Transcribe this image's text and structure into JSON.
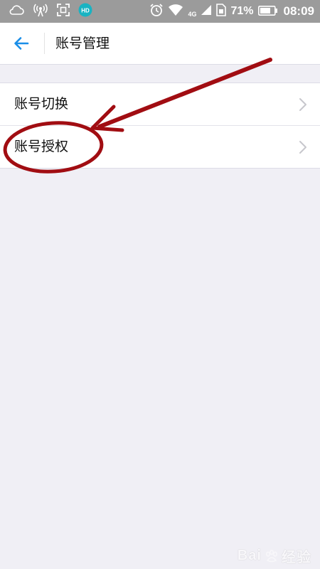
{
  "status_bar": {
    "network": "4G",
    "battery": "71%",
    "time": "08:09",
    "left_icons": [
      "cloud-icon",
      "hotspot-icon",
      "screenshot-icon",
      "hd-app-icon"
    ],
    "right_icons": [
      "alarm-icon",
      "wifi-icon",
      "signal-icon",
      "sim-icon",
      "battery-icon"
    ]
  },
  "header": {
    "title": "账号管理",
    "back_icon": "back-arrow-icon"
  },
  "list": {
    "items": [
      {
        "label": "账号切换",
        "icon": "chevron-right-icon"
      },
      {
        "label": "账号授权",
        "icon": "chevron-right-icon"
      }
    ]
  },
  "annotation": {
    "color": "#a10d12",
    "shapes": [
      "arrow",
      "ellipse"
    ]
  },
  "watermark": {
    "brand": "Bai",
    "suffix": "经验",
    "icon": "baidu-paw-icon"
  },
  "colors": {
    "accent": "#1a8ee8",
    "status_bar": "#9b9b9b",
    "background": "#f0eff5",
    "hd_badge": "#19b3c2"
  }
}
